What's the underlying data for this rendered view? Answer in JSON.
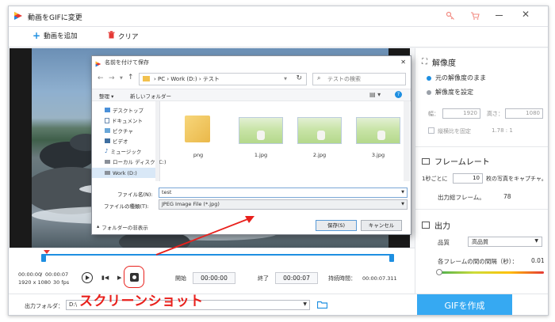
{
  "app": {
    "title": "動画をGIFに変更",
    "add_video": "動画を追加",
    "clear": "クリア"
  },
  "controls": {
    "time_current": "00:00:00",
    "time_total": "00:00:07",
    "resolution": "1920 x 1080",
    "fps": "30 fps",
    "start_label": "開始",
    "start_time": "00:00:00",
    "end_label": "終了",
    "end_time": "00:00:07",
    "duration_label": "持続時間：",
    "duration": "00:00:07.311"
  },
  "bottom": {
    "output_label": "出力フォルダ：",
    "output_value": "D:\\",
    "create_button": "GIFを作成"
  },
  "settings": {
    "resolution_title": "解像度",
    "keep_original": "元の解像度のまま",
    "set_resolution": "解像度を設定",
    "width_label": "幅：",
    "width_value": "1920",
    "height_label": "高さ：",
    "height_value": "1080",
    "keep_ratio": "縦横比を固定",
    "ratio_value": "1.78 : 1",
    "framerate_title": "フレームレート",
    "per_second_prefix": "1秒ごとに",
    "per_second_value": "10",
    "per_second_suffix": "枚の写真をキャプチャ。",
    "total_frames_label": "出力総フレーム。",
    "total_frames_value": "78",
    "output_title": "出力",
    "quality_label": "品質",
    "quality_value": "高品質",
    "interval_label": "各フレームの間の間隔（秒）：",
    "interval_value": "0.01"
  },
  "dialog": {
    "title": "名前を付けて保存",
    "path": [
      "PC",
      "Work (D:)",
      "テスト"
    ],
    "search_placeholder": "テストの検索",
    "organize": "整理 ▾",
    "new_folder": "新しいフォルダー",
    "tree": [
      "デスクトップ",
      "ドキュメント",
      "ピクチャ",
      "ビデオ",
      "ミュージック",
      "ローカル ディスク (C:)",
      "Work (D:)"
    ],
    "files": [
      "png",
      "1.jpg",
      "2.jpg",
      "3.jpg"
    ],
    "filename_label": "ファイル名(N):",
    "filename_value": "test",
    "filetype_label": "ファイルの種類(T):",
    "filetype_value": "JPEG Image File (*.jpg)",
    "hide_folders": "フォルダーの非表示",
    "save": "保存(S)",
    "cancel": "キャンセル"
  },
  "annotation": {
    "label": "スクリーンショット",
    "color": "#e8201c"
  },
  "colors": {
    "accent": "#1e8fe1",
    "create_button_bg": "#36a9f2",
    "timeline": "#1e8fe1"
  }
}
